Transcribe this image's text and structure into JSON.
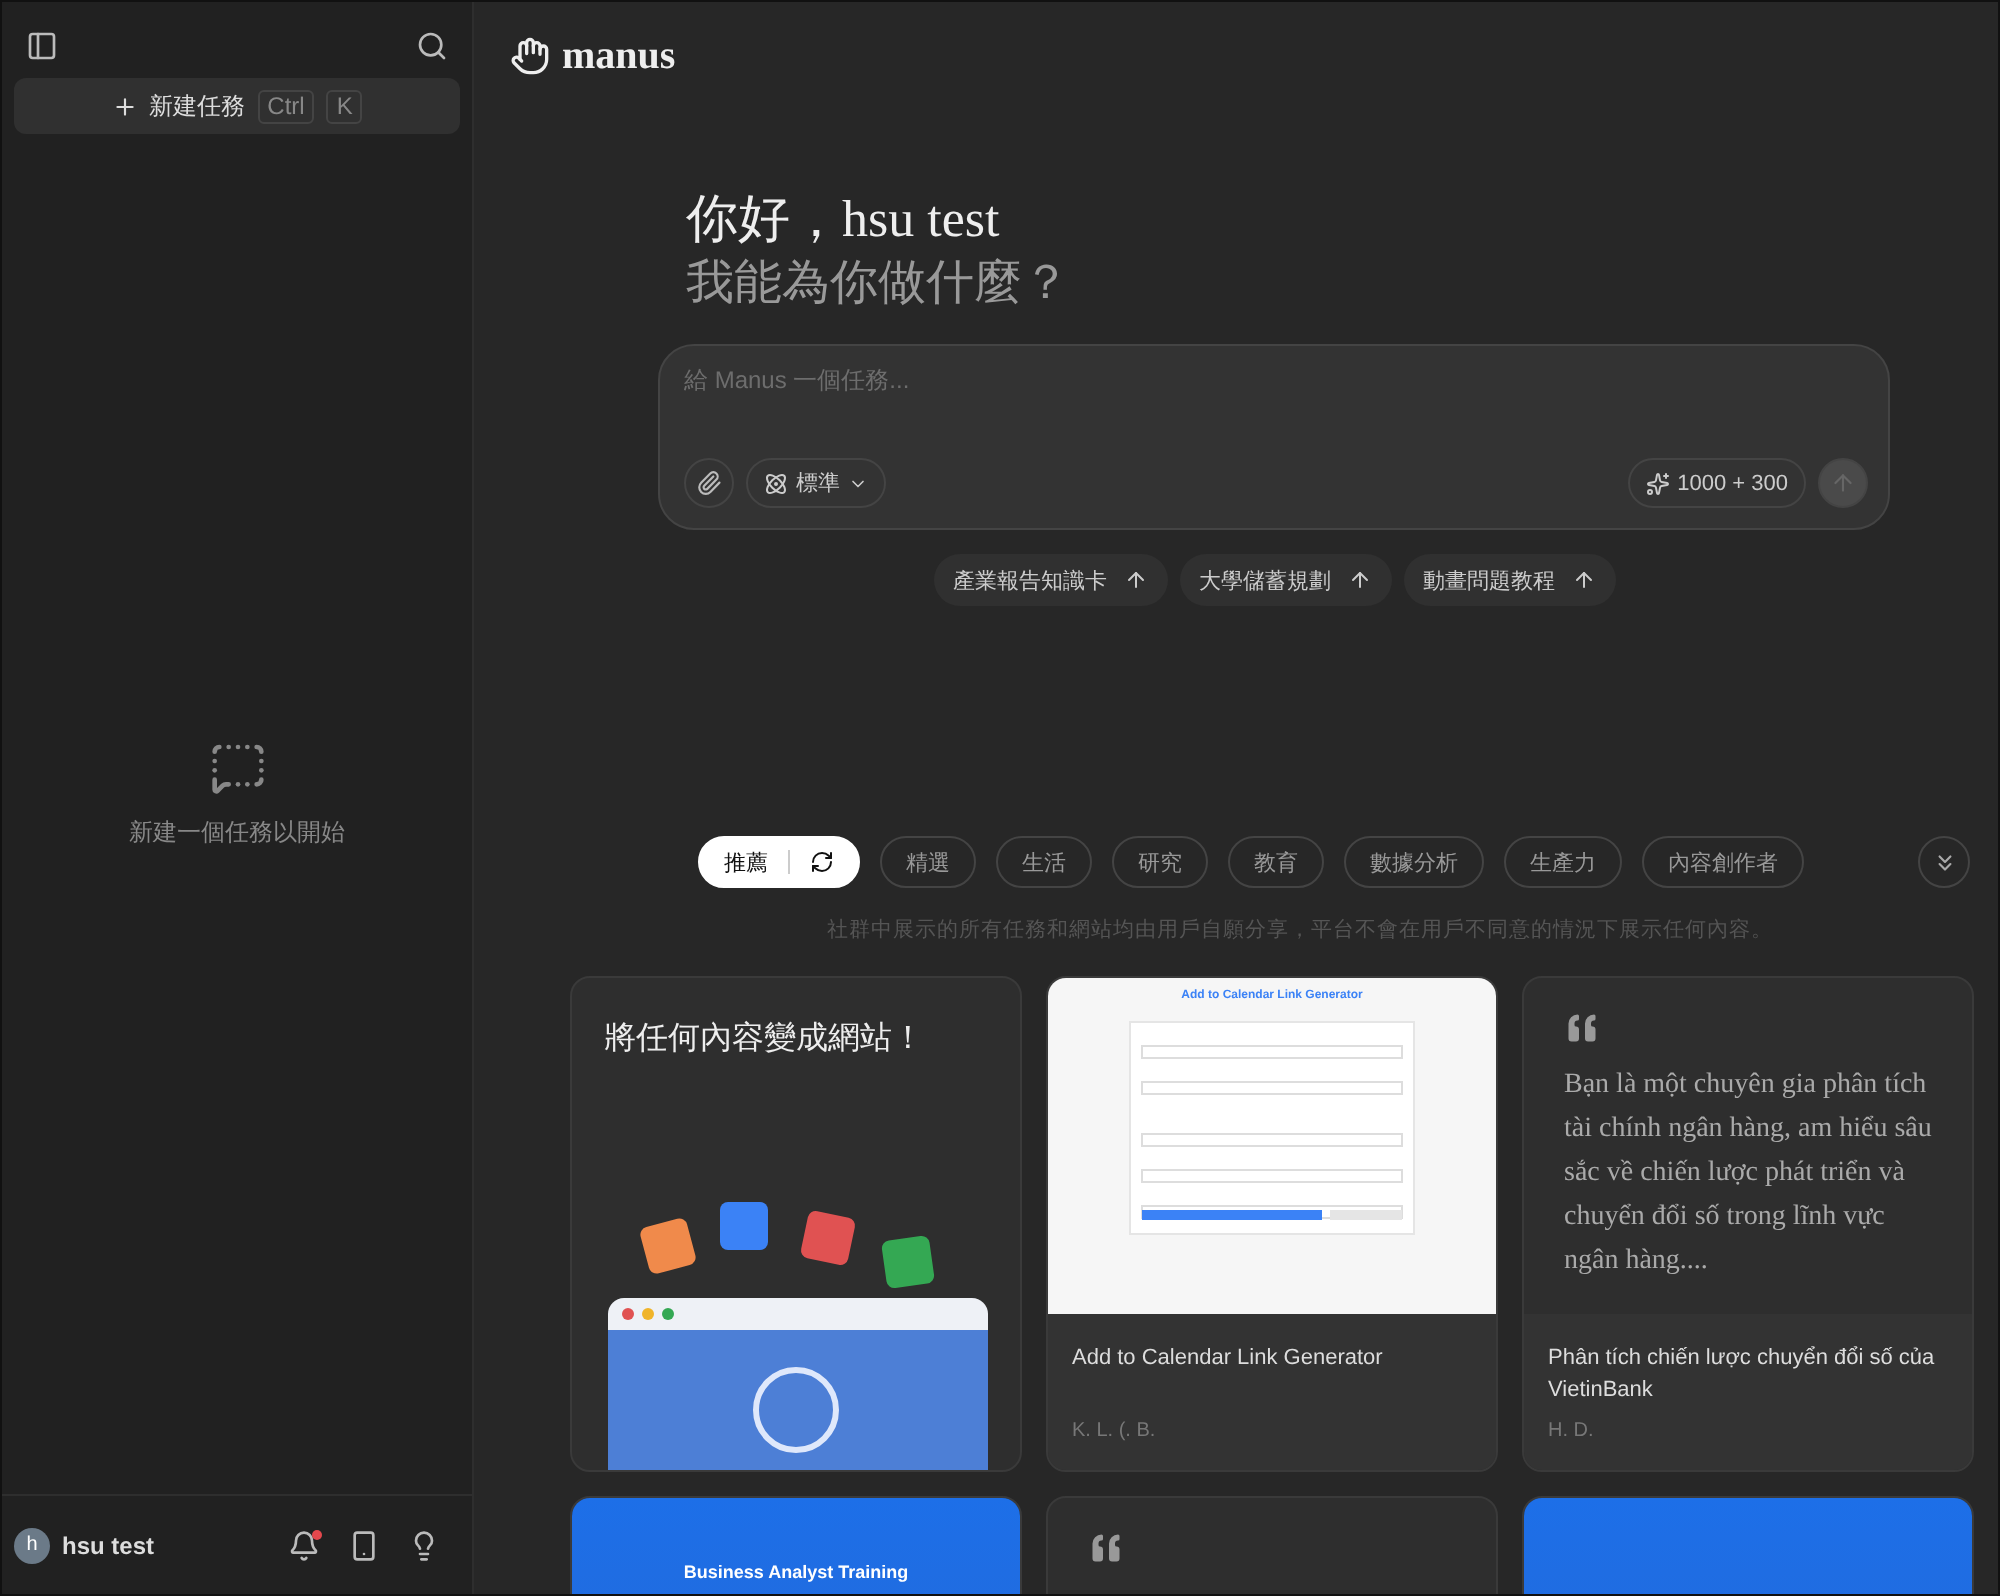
{
  "sidebar": {
    "new_task": {
      "label": "新建任務",
      "keys": [
        "Ctrl",
        "K"
      ]
    },
    "empty_message": "新建一個任務以開始",
    "user": {
      "initial": "h",
      "name": "hsu test",
      "has_notification": true
    }
  },
  "header": {
    "logo": "manus"
  },
  "greeting": {
    "hello": "你好，hsu test",
    "question": "我能為你做什麼？"
  },
  "composer": {
    "placeholder": "給 Manus 一個任務...",
    "mode": "標準",
    "credits": "1000 + 300",
    "send_disabled": true
  },
  "suggestions": [
    "產業報告知識卡",
    "大學儲蓄規劃",
    "動畫問題教程"
  ],
  "filters": [
    {
      "label": "推薦",
      "selected": true
    },
    {
      "label": "精選",
      "selected": false
    },
    {
      "label": "生活",
      "selected": false
    },
    {
      "label": "研究",
      "selected": false
    },
    {
      "label": "教育",
      "selected": false
    },
    {
      "label": "數據分析",
      "selected": false
    },
    {
      "label": "生產力",
      "selected": false
    },
    {
      "label": "內容創作者",
      "selected": false
    }
  ],
  "disclaimer": "社群中展示的所有任務和網站均由用戶自願分享，平台不會在用戶不同意的情況下展示任何內容。",
  "cards": [
    {
      "kind": "illustration",
      "title": "將任何內容變成網站！"
    },
    {
      "kind": "preview",
      "preview_title": "Add to Calendar Link Generator",
      "title": "Add to Calendar Link Generator",
      "author": "K. L. (. B."
    },
    {
      "kind": "quote",
      "quote": "Bạn là một chuyên gia phân tích tài chính ngân hàng, am hiểu sâu sắc về chiến lược phát triển và chuyển đổi số trong lĩnh vực ngân hàng....",
      "title": "Phân tích chiến lược chuyển đổi số của VietinBank",
      "author": "H. D."
    },
    {
      "kind": "preview",
      "preview_title": "Business Analyst Training"
    },
    {
      "kind": "quote"
    },
    {
      "kind": "preview"
    }
  ]
}
